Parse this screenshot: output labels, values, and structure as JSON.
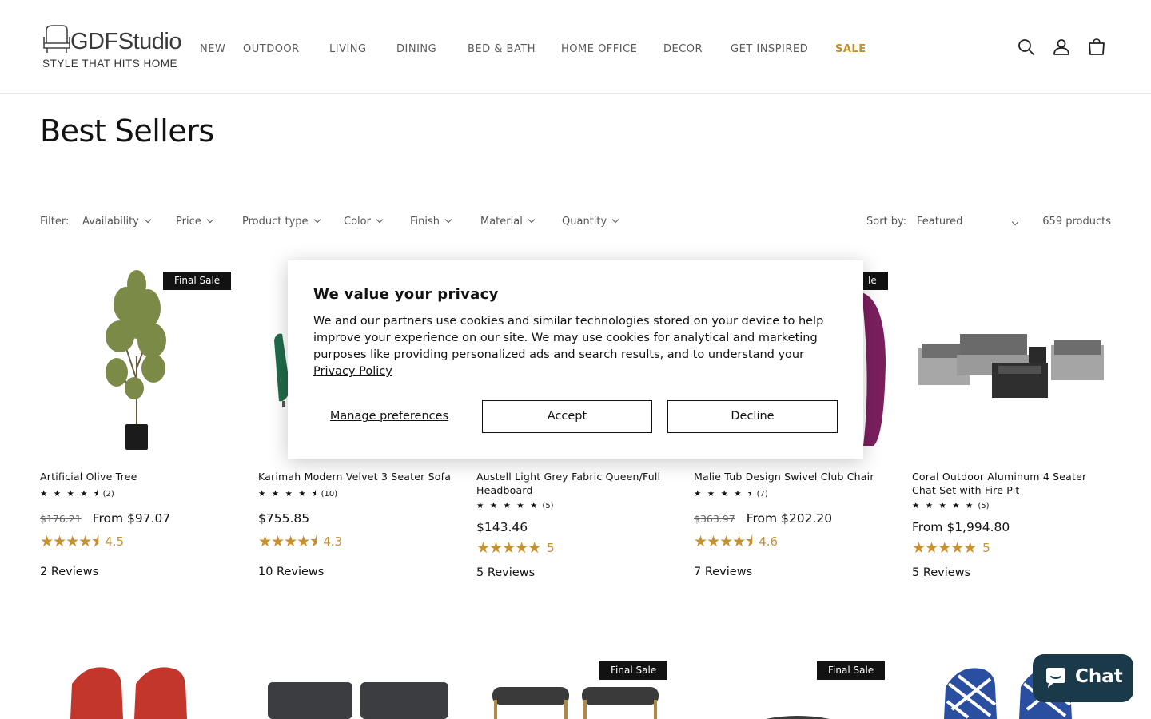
{
  "brand": {
    "name": "GDFStudio",
    "tagline": "STYLE THAT HITS HOME"
  },
  "nav": [
    {
      "label": "NEW"
    },
    {
      "label": "OUTDOOR"
    },
    {
      "label": "LIVING"
    },
    {
      "label": "DINING"
    },
    {
      "label": "BED & BATH"
    },
    {
      "label": "HOME OFFICE"
    },
    {
      "label": "DECOR"
    },
    {
      "label": "GET INSPIRED"
    },
    {
      "label": "SALE"
    }
  ],
  "header_icons": [
    "search-icon",
    "account-icon",
    "cart-icon"
  ],
  "page_title": "Best Sellers",
  "filters": {
    "label": "Filter:",
    "items": [
      "Availability",
      "Price",
      "Product type",
      "Color",
      "Finish",
      "Material",
      "Quantity"
    ],
    "sort_label": "Sort by:",
    "sort_value": "Featured",
    "product_count": "659 products"
  },
  "colors": {
    "accent_gold": "#c8902f",
    "sale_nav": "#c0902e",
    "chat_bg": "#1a3a4a",
    "badge_bg": "#121212"
  },
  "products": [
    {
      "title": "Artificial Olive Tree",
      "badge": "Final Sale",
      "mini_stars": "★ ★ ★ ★ ⯨",
      "mini_count": "(2)",
      "price_old": "$176.21",
      "price": "From $97.07",
      "stars": "★★★★⯨",
      "rating": "4.5",
      "reviews": "2 Reviews"
    },
    {
      "title": "Karimah Modern Velvet 3 Seater Sofa",
      "badge": "",
      "mini_stars": "★ ★ ★ ★ ⯨",
      "mini_count": "(10)",
      "price_old": "",
      "price": "$755.85",
      "stars": "★★★★⯨",
      "rating": "4.3",
      "reviews": "10 Reviews"
    },
    {
      "title": "Austell Light Grey Fabric Queen/Full Headboard",
      "badge": "",
      "mini_stars": "★ ★ ★ ★ ★",
      "mini_count": "(5)",
      "price_old": "",
      "price": "$143.46",
      "stars": "★★★★★",
      "rating": "5",
      "reviews": "5 Reviews"
    },
    {
      "title": "Malie Tub Design Swivel Club Chair",
      "badge": "le",
      "mini_stars": "★ ★ ★ ★ ⯨",
      "mini_count": "(7)",
      "price_old": "$363.97",
      "price": "From $202.20",
      "stars": "★★★★⯨",
      "rating": "4.6",
      "reviews": "7 Reviews"
    },
    {
      "title": "Coral Outdoor Aluminum 4 Seater Chat Set with Fire Pit",
      "badge": "",
      "mini_stars": "★ ★ ★ ★ ★",
      "mini_count": "(5)",
      "price_old": "",
      "price": "From $1,994.80",
      "stars": "★★★★★",
      "rating": "5",
      "reviews": "5 Reviews"
    }
  ],
  "row2_badges": [
    "Final Sale",
    "Final Sale"
  ],
  "cookie": {
    "title": "We value your privacy",
    "body": "We and our partners use cookies and similar technologies stored on your device to help improve your experience on our site. We may use cookies for analytical and marketing purposes like providing personalized ads and search results, and to understand your ",
    "link": "Privacy Policy",
    "manage": "Manage preferences",
    "accept": "Accept",
    "decline": "Decline"
  },
  "chat": {
    "label": "Chat"
  }
}
